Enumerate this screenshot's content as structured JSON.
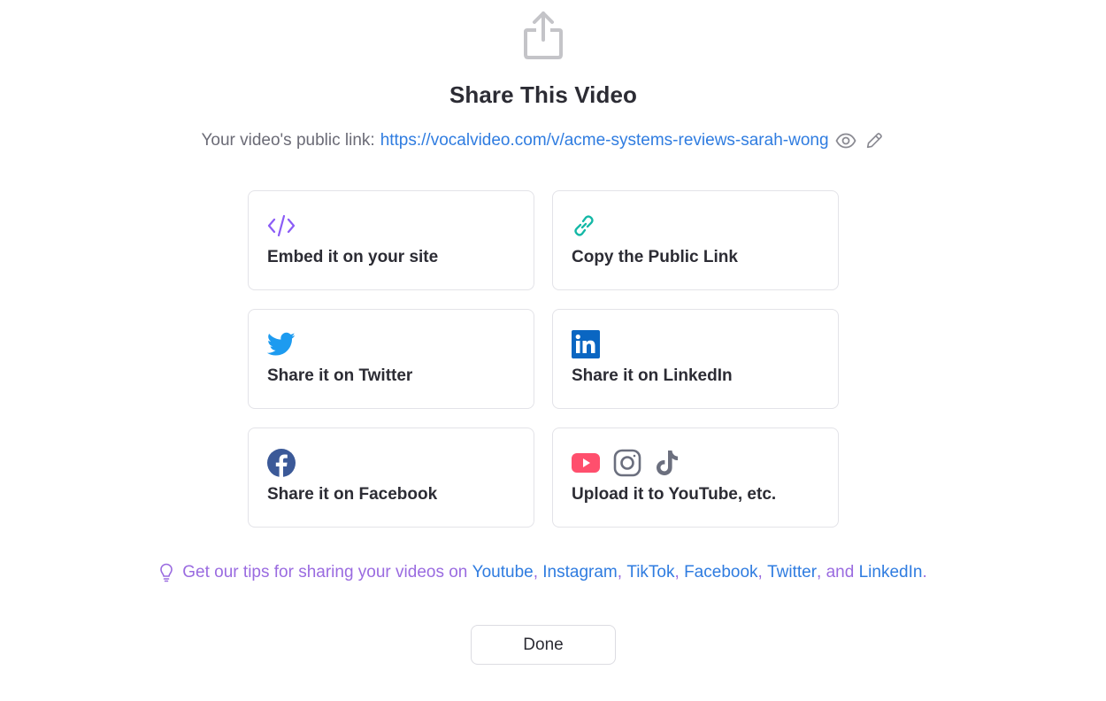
{
  "dialog": {
    "title": "Share This Video",
    "public_link_label": "Your video's public link:",
    "public_link_url": "https://vocalvideo.com/v/acme-systems-reviews-sarah-wong"
  },
  "options": [
    {
      "label": "Embed it on your site",
      "icon": "code-icon",
      "color": "#8b5cf6"
    },
    {
      "label": "Copy the Public Link",
      "icon": "link-icon",
      "color": "#14b8a6"
    },
    {
      "label": "Share it on Twitter",
      "icon": "twitter-icon",
      "color": "#1d9bf0"
    },
    {
      "label": "Share it on LinkedIn",
      "icon": "linkedin-icon",
      "color": "#0a66c2"
    },
    {
      "label": "Share it on Facebook",
      "icon": "facebook-icon",
      "color": "#3b5998"
    },
    {
      "label": "Upload it to YouTube, etc.",
      "icon": "youtube-instagram-tiktok-icons",
      "color": "#ff4f6d"
    }
  ],
  "tips": {
    "prefix": "Get our tips for sharing your videos on",
    "links": [
      "Youtube",
      "Instagram",
      "TikTok",
      "Facebook",
      "Twitter",
      "LinkedIn"
    ],
    "sep1": ",",
    "sep_and": ", and",
    "suffix": "."
  },
  "done_label": "Done"
}
